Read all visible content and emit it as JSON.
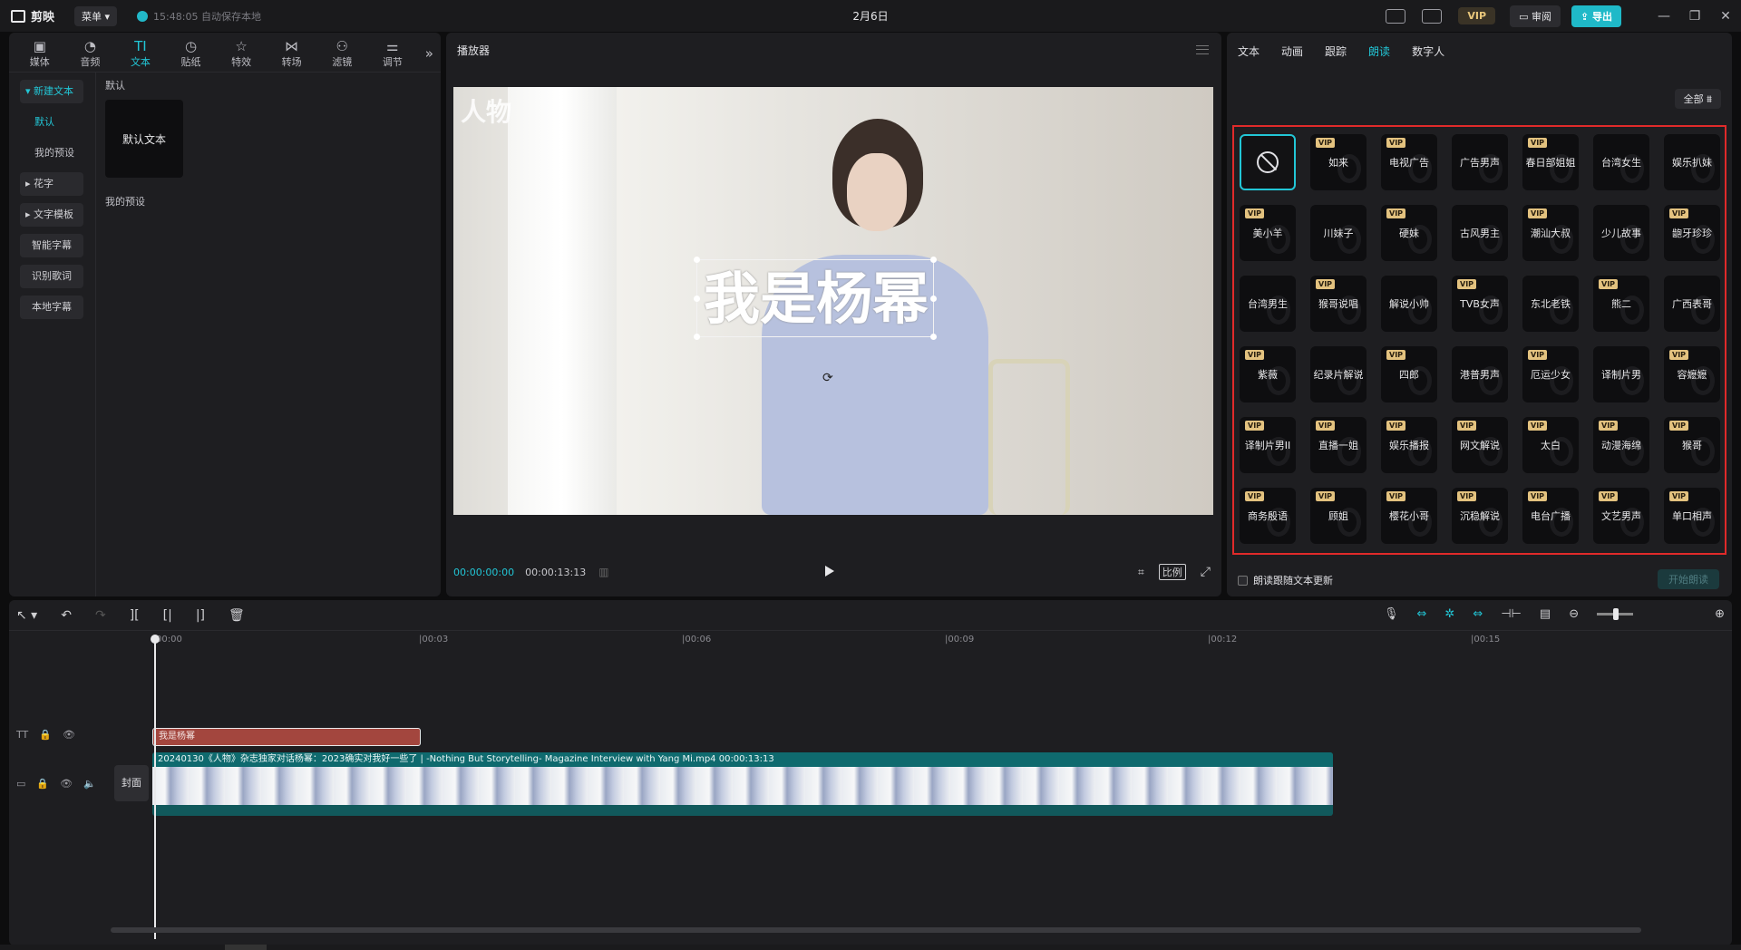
{
  "titlebar": {
    "app_name": "剪映",
    "menu_label": "菜单",
    "autosave": "15:48:05 自动保存本地",
    "window_title": "2月6日",
    "vip": "VIP",
    "review": "审阅",
    "export": "导出"
  },
  "tools": [
    {
      "label": "媒体",
      "icon": "media-icon"
    },
    {
      "label": "音频",
      "icon": "audio-icon"
    },
    {
      "label": "文本",
      "icon": "text-icon",
      "active": true
    },
    {
      "label": "贴纸",
      "icon": "sticker-icon"
    },
    {
      "label": "特效",
      "icon": "effects-icon"
    },
    {
      "label": "转场",
      "icon": "transition-icon"
    },
    {
      "label": "滤镜",
      "icon": "filter-icon"
    },
    {
      "label": "调节",
      "icon": "adjust-icon"
    }
  ],
  "sidebar": {
    "new_text": "新建文本",
    "default": "默认",
    "my_presets": "我的预设",
    "huazi": "花字",
    "templates": "文字模板",
    "smart_captions": "智能字幕",
    "lyrics": "识别歌词",
    "local_captions": "本地字幕"
  },
  "content": {
    "section_default": "默认",
    "default_text_card": "默认文本",
    "section_presets": "我的预设"
  },
  "player": {
    "title": "播放器",
    "watermark": "人物",
    "overlay_text": "我是杨幂",
    "current_time": "00:00:00:00",
    "total_time": "00:00:13:13",
    "ratio_label": "比例"
  },
  "right_panel": {
    "tabs": [
      "文本",
      "动画",
      "跟踪",
      "朗读",
      "数字人"
    ],
    "active_tab": "朗读",
    "filter_label": "全部",
    "voices": [
      {
        "label": "",
        "vip": false,
        "none": true
      },
      {
        "label": "如来",
        "vip": true
      },
      {
        "label": "电视广告",
        "vip": true
      },
      {
        "label": "广告男声",
        "vip": false
      },
      {
        "label": "春日部姐姐",
        "vip": true
      },
      {
        "label": "台湾女生",
        "vip": false
      },
      {
        "label": "娱乐扒妹",
        "vip": false
      },
      {
        "label": "美小羊",
        "vip": true
      },
      {
        "label": "川妹子",
        "vip": false
      },
      {
        "label": "硬妹",
        "vip": true
      },
      {
        "label": "古风男主",
        "vip": false
      },
      {
        "label": "潮汕大叔",
        "vip": true
      },
      {
        "label": "少儿故事",
        "vip": false
      },
      {
        "label": "龅牙珍珍",
        "vip": true
      },
      {
        "label": "台湾男生",
        "vip": false
      },
      {
        "label": "猴哥说唱",
        "vip": true
      },
      {
        "label": "解说小帅",
        "vip": false
      },
      {
        "label": "TVB女声",
        "vip": true
      },
      {
        "label": "东北老铁",
        "vip": false
      },
      {
        "label": "熊二",
        "vip": true
      },
      {
        "label": "广西表哥",
        "vip": false
      },
      {
        "label": "紫薇",
        "vip": true
      },
      {
        "label": "纪录片解说",
        "vip": false
      },
      {
        "label": "四郎",
        "vip": true
      },
      {
        "label": "港普男声",
        "vip": false
      },
      {
        "label": "厄运少女",
        "vip": true
      },
      {
        "label": "译制片男",
        "vip": false
      },
      {
        "label": "容嬷嬷",
        "vip": true
      },
      {
        "label": "译制片男II",
        "vip": true
      },
      {
        "label": "直播一姐",
        "vip": true
      },
      {
        "label": "娱乐播报",
        "vip": true
      },
      {
        "label": "网文解说",
        "vip": true
      },
      {
        "label": "太白",
        "vip": true
      },
      {
        "label": "动漫海绵",
        "vip": true
      },
      {
        "label": "猴哥",
        "vip": true
      },
      {
        "label": "商务殷语",
        "vip": true
      },
      {
        "label": "顾姐",
        "vip": true
      },
      {
        "label": "樱花小哥",
        "vip": true
      },
      {
        "label": "沉稳解说",
        "vip": true
      },
      {
        "label": "电台广播",
        "vip": true
      },
      {
        "label": "文艺男声",
        "vip": true
      },
      {
        "label": "单口相声",
        "vip": true
      }
    ],
    "follow_text_label": "朗读跟随文本更新",
    "start_button": "开始朗读"
  },
  "timeline": {
    "ticks": [
      "00:00",
      "00:03",
      "00:06",
      "00:09",
      "00:12",
      "00:15"
    ],
    "text_clip_label": "我是杨幂",
    "cover_label": "封面",
    "video_clip_label": "20240130《人物》杂志独家对话杨幂：2023确实对我好一些了 | -Nothing But Storytelling- Magazine Interview with Yang Mi.mp4   00:00:13:13"
  },
  "colors": {
    "accent": "#22c6d6",
    "highlight_border": "#e02a2a",
    "vip": "#e3c27f",
    "text_clip": "#a3463e",
    "video_clip": "#11595c"
  }
}
